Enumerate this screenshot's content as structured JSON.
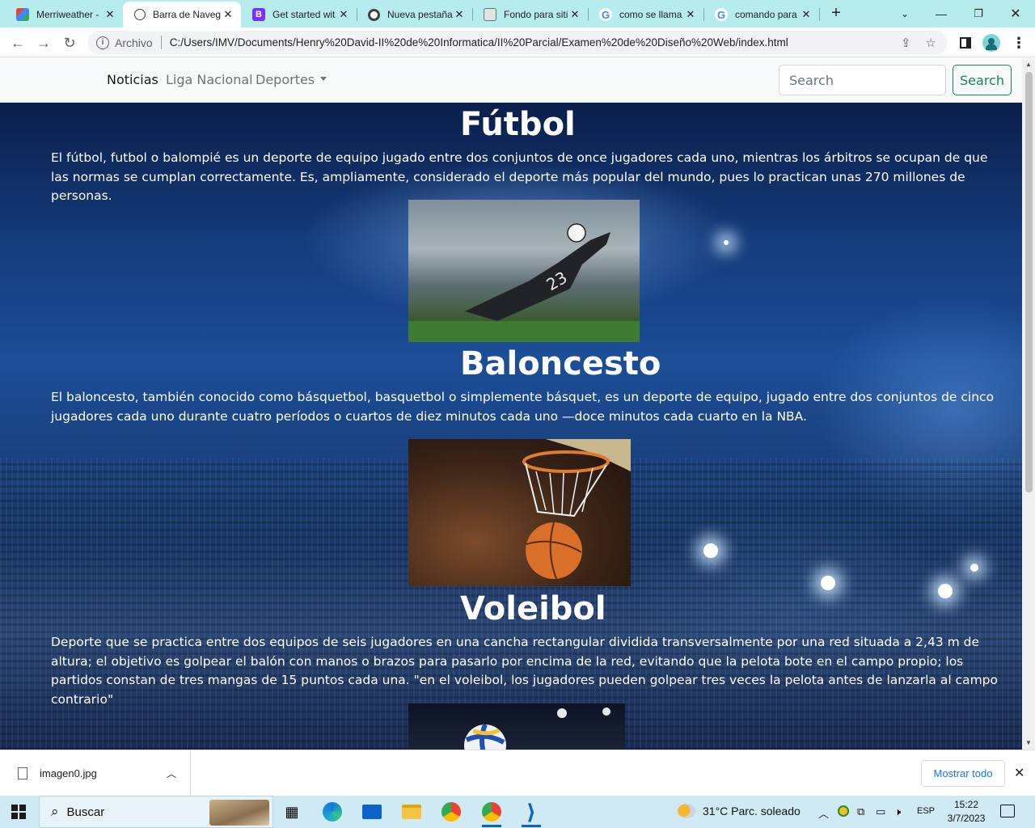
{
  "browser": {
    "tabs": [
      {
        "label": "Merriweather - ",
        "icon": "google-fonts-icon",
        "active": false
      },
      {
        "label": "Barra de Naveg",
        "icon": "globe-icon",
        "active": true
      },
      {
        "label": "Get started wit",
        "icon": "bootstrap-icon",
        "active": false
      },
      {
        "label": "Nueva pestaña",
        "icon": "chrome-icon",
        "active": false
      },
      {
        "label": "Fondo para siti",
        "icon": "image-site-icon",
        "active": false
      },
      {
        "label": "como se llama",
        "icon": "google-icon",
        "active": false
      },
      {
        "label": "comando para",
        "icon": "google-icon",
        "active": false
      }
    ],
    "address": {
      "scheme_label": "Archivo",
      "url": "C:/Users/IMV/Documents/Henry%20David-II%20de%20Informatica/II%20Parcial/Examen%20de%20Diseño%20Web/index.html"
    }
  },
  "navbar": {
    "links": [
      {
        "label": "Noticias",
        "active": true
      },
      {
        "label": "Liga Nacional",
        "active": false
      },
      {
        "label": "Deportes",
        "dropdown": true
      }
    ],
    "search_placeholder": "Search",
    "search_button": "Search"
  },
  "sections": [
    {
      "title": "Fútbol",
      "text": "El fútbol, futbol o balompié es un deporte de equipo jugado entre dos conjuntos de once jugadores cada uno, mientras los árbitros se ocupan de que las normas se cumplan correctamente. Es, ampliamente, considerado el deporte más popular del mundo, pues lo practican unas 270 millones de personas.",
      "image": "soccer-goalkeeper-photo"
    },
    {
      "title": "Baloncesto",
      "text": "El baloncesto, también conocido como básquetbol, basquetbol o simplemente básquet,  es un deporte de equipo, jugado entre dos conjuntos de cinco jugadores cada uno durante cuatro períodos o cuartos de diez minutos cada uno —doce minutos cada cuarto en la NBA.",
      "image": "basketball-hoop-photo"
    },
    {
      "title": "Voleibol",
      "text": "Deporte que se practica entre dos equipos de seis jugadores en una cancha rectangular dividida transversalmente por una red situada a 2,43 m de altura; el objetivo es golpear el balón con manos o brazos para pasarlo por encima de la red, evitando que la pelota bote en el campo propio; los partidos constan de tres mangas de 15 puntos cada una. \"en el voleibol, los jugadores pueden golpear tres veces la pelota antes de lanzarla al campo contrario\"",
      "image": "volleyball-photo"
    }
  ],
  "downloads": {
    "file_name": "imagen0.jpg",
    "show_all": "Mostrar todo"
  },
  "taskbar": {
    "search_label": "Buscar",
    "weather": "31°C  Parc. soleado",
    "language": "ESP",
    "time": "15:22",
    "date": "3/7/2023"
  },
  "colors": {
    "tabstrip": "#b7ecef",
    "search_button": "#198754",
    "link_blue": "#1a73e8"
  }
}
